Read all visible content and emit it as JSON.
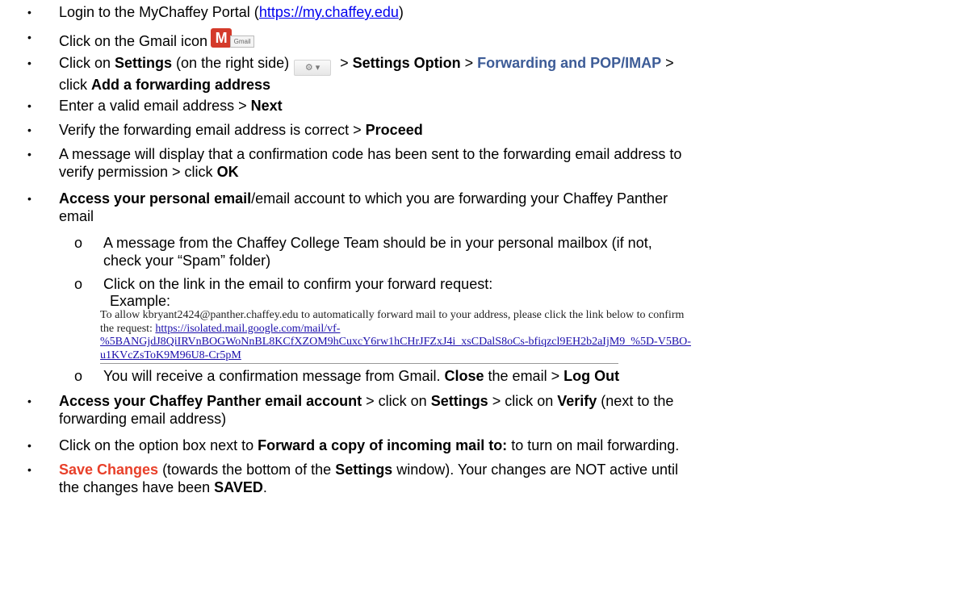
{
  "steps": {
    "s1": {
      "a": "Login to the MyChaffey Portal (",
      "link": "https://my.chaffey.edu",
      "b": ")"
    },
    "s2": {
      "a": "Click on the Gmail icon",
      "icon_label": "Gmail",
      "icon": "gmail-icon"
    },
    "s3": {
      "a": "Click on ",
      "b1": "Settings",
      "c": " (on the right side)",
      "d": " > ",
      "b2": "Settings Option",
      "e": " > ",
      "blue": "Forwarding and POP/IMAP",
      "f": " >",
      "g": "click ",
      "b3": "Add a forwarding address"
    },
    "s4": {
      "a": "Enter a valid email address > ",
      "b": "Next"
    },
    "s5": {
      "a": "Verify the forwarding email address is correct > ",
      "b": "Proceed"
    },
    "s6": {
      "a": "A message will display that a confirmation code has been sent to the forwarding email address to",
      "c": "verify permission > click ",
      "b": "OK"
    },
    "s7": {
      "b": "Access your personal email",
      "a": "/email account to which you are forwarding your Chaffey Panther",
      "c": "email"
    },
    "sub1": {
      "a": "A message from the Chaffey College Team should be in your personal mailbox (if not,",
      "c": "check your “Spam” folder)"
    },
    "sub2": {
      "a": "Click on the link in the email to confirm your forward request:",
      "example": "Example:"
    },
    "example_text": {
      "a": "To allow kbryant2424@panther.chaffey.edu to automatically forward mail to your address, please click the link below to confirm",
      "b": "the request: ",
      "link1": "https://isolated.mail.google.com/mail/vf-",
      "link2": "%5BANGjdJ8QiIRVnBOGWoNnBL8KCfXZOM9hCuxcY6rw1hCHrJFZxJ4i_xsCDalS8oCs-bfiqzcl9EH2b2aIjM9_%5D-V5BO-",
      "link3": "u1KVcZsToK9M96U8-Cr5pM"
    },
    "sub3": {
      "a": "You will receive a confirmation message from Gmail.  ",
      "b1": "Close",
      "c": " the email > ",
      "b2": "Log Out"
    },
    "s8": {
      "b1": "Access your Chaffey Panther email account",
      "a": " > click on ",
      "b2": "Settings",
      "c": " > click on ",
      "b3": "Verify",
      "d": " (next to the",
      "e": "forwarding email address)"
    },
    "s9": {
      "a": "Click on the option box next to ",
      "b": "Forward a copy of incoming mail to:",
      "c": " to turn on mail forwarding."
    },
    "s10": {
      "red": "Save Changes",
      "a": " (towards the bottom of the ",
      "b1": "Settings",
      "c": " window).  Your changes are NOT active until",
      "d": "the changes have been ",
      "b2": "SAVED",
      "e": "."
    }
  },
  "bullet_glyph": "•",
  "sub_bullet_glyph": "o",
  "colors": {
    "accent_blue": "#3d5c97",
    "accent_red": "#e8402a",
    "link": "#0000ee"
  }
}
